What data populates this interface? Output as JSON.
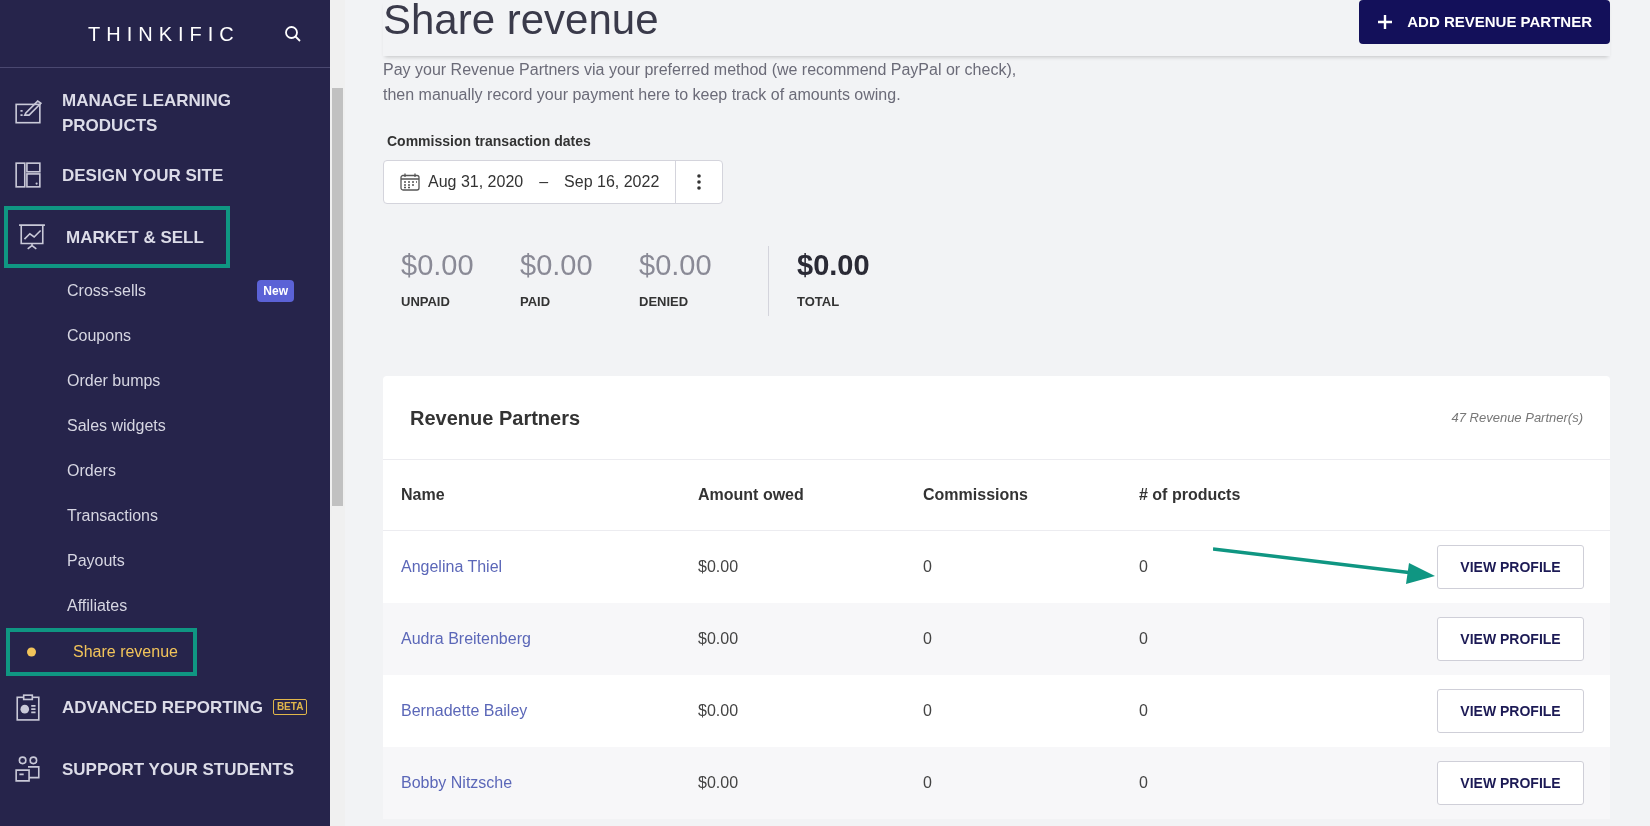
{
  "sidebar": {
    "logo": "THINKIFIC",
    "nav": [
      {
        "kind": "section",
        "label": "MANAGE LEARNING PRODUCTS",
        "highlighted": false
      },
      {
        "kind": "section",
        "label": "DESIGN YOUR SITE",
        "highlighted": false
      },
      {
        "kind": "section",
        "label": "MARKET & SELL",
        "highlighted": true,
        "children": [
          {
            "label": "Cross-sells",
            "badge": "New",
            "selected": false,
            "highlighted": false
          },
          {
            "label": "Coupons",
            "selected": false,
            "highlighted": false
          },
          {
            "label": "Order bumps",
            "selected": false,
            "highlighted": false
          },
          {
            "label": "Sales widgets",
            "selected": false,
            "highlighted": false
          },
          {
            "label": "Orders",
            "selected": false,
            "highlighted": false
          },
          {
            "label": "Transactions",
            "selected": false,
            "highlighted": false
          },
          {
            "label": "Payouts",
            "selected": false,
            "highlighted": false
          },
          {
            "label": "Affiliates",
            "selected": false,
            "highlighted": false
          },
          {
            "label": "Share revenue",
            "selected": true,
            "highlighted": true
          }
        ]
      },
      {
        "kind": "section",
        "label": "ADVANCED REPORTING",
        "tag": "BETA",
        "highlighted": false
      },
      {
        "kind": "section",
        "label": "SUPPORT YOUR STUDENTS",
        "highlighted": false
      }
    ]
  },
  "header": {
    "title": "Share revenue",
    "button": "ADD REVENUE PARTNER"
  },
  "description": "Pay your Revenue Partners via your preferred method (we recommend PayPal or check),\nthen manually record your payment here to keep track of amounts owing.",
  "date_filter": {
    "label": "Commission transaction dates",
    "start": "Aug 31, 2020",
    "separator": "–",
    "end": "Sep 16, 2022"
  },
  "stats": [
    {
      "kind": "part",
      "value": "$0.00",
      "label": "UNPAID"
    },
    {
      "kind": "part",
      "value": "$0.00",
      "label": "PAID"
    },
    {
      "kind": "part",
      "value": "$0.00",
      "label": "DENIED"
    },
    {
      "kind": "total",
      "value": "$0.00",
      "label": "TOTAL"
    }
  ],
  "table": {
    "title": "Revenue Partners",
    "count": "47 Revenue Partner(s)",
    "columns": [
      "Name",
      "Amount owed",
      "Commissions",
      "# of products"
    ],
    "rows": [
      {
        "name": "Angelina Thiel",
        "amount": "$0.00",
        "commissions": "0",
        "products": "0",
        "action": "VIEW PROFILE",
        "pointed_at": true
      },
      {
        "name": "Audra Breitenberg",
        "amount": "$0.00",
        "commissions": "0",
        "products": "0",
        "action": "VIEW PROFILE",
        "pointed_at": false
      },
      {
        "name": "Bernadette Bailey",
        "amount": "$0.00",
        "commissions": "0",
        "products": "0",
        "action": "VIEW PROFILE",
        "pointed_at": false
      },
      {
        "name": "Bobby Nitzsche",
        "amount": "$0.00",
        "commissions": "0",
        "products": "0",
        "action": "VIEW PROFILE",
        "pointed_at": false
      }
    ]
  }
}
